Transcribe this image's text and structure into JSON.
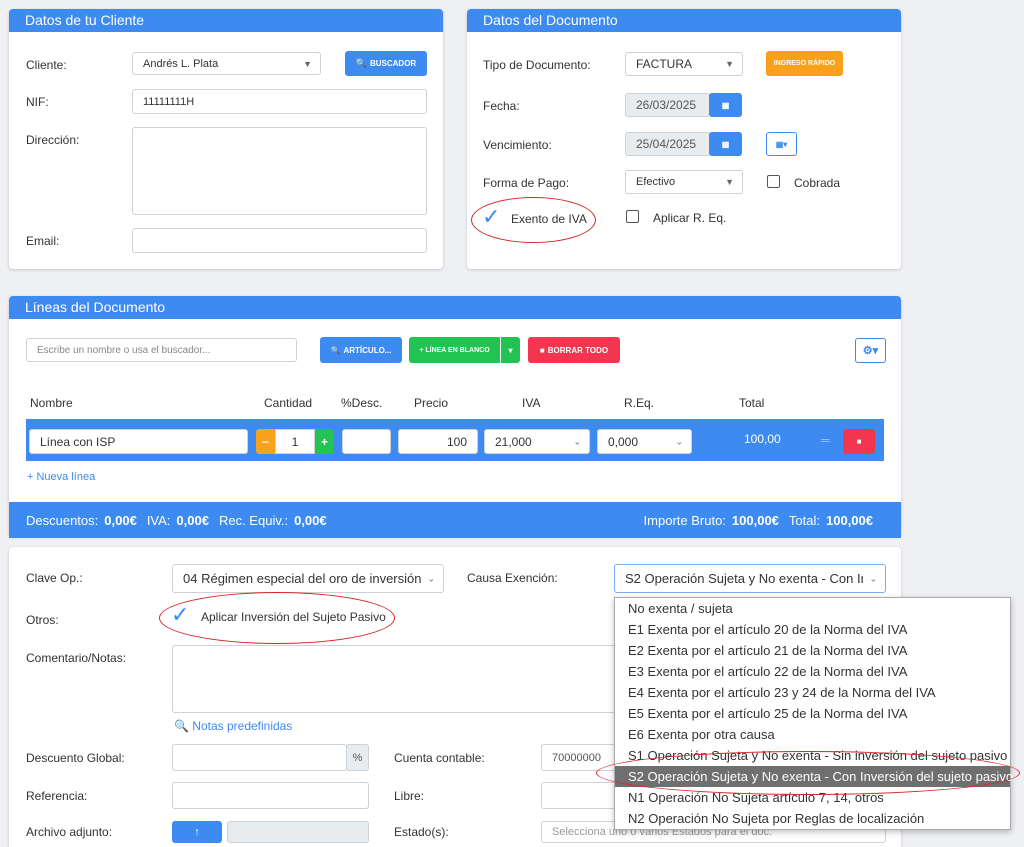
{
  "client_card": {
    "title": "Datos de tu Cliente",
    "cliente_label": "Cliente:",
    "cliente_value": "Andrés L. Plata",
    "buscador_label": "BUSCADOR",
    "nif_label": "NIF:",
    "nif_value": "11111111H",
    "direccion_label": "Dirección:",
    "email_label": "Email:"
  },
  "doc_card": {
    "title": "Datos del Documento",
    "tipo_label": "Tipo de Documento:",
    "tipo_value": "FACTURA",
    "ingreso_label": "INGRESO RÁPIDO",
    "fecha_label": "Fecha:",
    "fecha_value": "26/03/2025",
    "venc_label": "Vencimiento:",
    "venc_value": "25/04/2025",
    "forma_label": "Forma de Pago:",
    "forma_value": "Efectivo",
    "cobrada_label": "Cobrada",
    "exento_label": "Exento de IVA",
    "req_label": "Aplicar R. Eq."
  },
  "lines_card": {
    "title": "Líneas del Documento",
    "search_placeholder": "Escribe un nombre o usa el buscador...",
    "articulo_label": "ARTÍCULO...",
    "linea_blanco_label": "+ LÍNEA EN BLANCO",
    "borrar_label": "BORRAR TODO",
    "headers": [
      "Nombre",
      "Cantidad",
      "%Desc.",
      "Precio",
      "IVA",
      "R.Eq.",
      "Total"
    ],
    "row": {
      "nombre": "Línea con ISP",
      "cantidad": "1",
      "descuento": "",
      "precio": "100",
      "iva": "21,000",
      "req": "0,000",
      "total": "100,00"
    },
    "nueva_linea": "+ Nueva línea"
  },
  "totals": {
    "descuentos_label": "Descuentos:",
    "descuentos_value": "0,00€",
    "iva_label": "IVA:",
    "iva_value": "0,00€",
    "rec_label": "Rec. Equiv.:",
    "rec_value": "0,00€",
    "bruto_label": "Importe Bruto:",
    "bruto_value": "100,00€",
    "total_label": "Total:",
    "total_value": "100,00€"
  },
  "footer_card": {
    "clave_label": "Clave Op.:",
    "clave_value": "04 Régimen especial del oro de inversión",
    "causa_label": "Causa Exención:",
    "causa_value": "S2 Operación Sujeta y No exenta - Con Inversión del sujeto pasivo",
    "otros_label": "Otros:",
    "isp_label": "Aplicar Inversión del Sujeto Pasivo",
    "comentario_label": "Comentario/Notas:",
    "notas_link": "Notas predefinidas",
    "descuento_label": "Descuento Global:",
    "pct": "%",
    "cuenta_label": "Cuenta contable:",
    "cuenta_value": "70000000",
    "referencia_label": "Referencia:",
    "libre_label": "Libre:",
    "archivo_label": "Archivo adjunto:",
    "estado_label": "Estado(s):",
    "estado_placeholder": "Selecciona uno o varios Estados para el doc."
  },
  "dropdown_options": [
    "No exenta / sujeta",
    "E1 Exenta por el artículo 20 de la Norma del IVA",
    "E2 Exenta por el artículo 21 de la Norma del IVA",
    "E3 Exenta por el artículo 22 de la Norma del IVA",
    "E4 Exenta por el artículo 23 y 24 de la Norma del IVA",
    "E5 Exenta por el artículo 25 de la Norma del IVA",
    "E6 Exenta por otra causa",
    "S1 Operación Sujeta y No exenta - Sin inversión del sujeto pasivo",
    "S2 Operación Sujeta y No exenta - Con Inversión del sujeto pasivo",
    "N1 Operación No Sujeta artículo 7, 14, otros",
    "N2 Operación No Sujeta por Reglas de localización"
  ],
  "dropdown_selected": "S2 Operación Sujeta y No exenta - Con Inversión del sujeto pasivo",
  "colors": {
    "accent": "#3d8bf0",
    "orange": "#f9a11b",
    "green": "#22c352",
    "red": "#f2364f",
    "annotation": "#d7262a"
  }
}
